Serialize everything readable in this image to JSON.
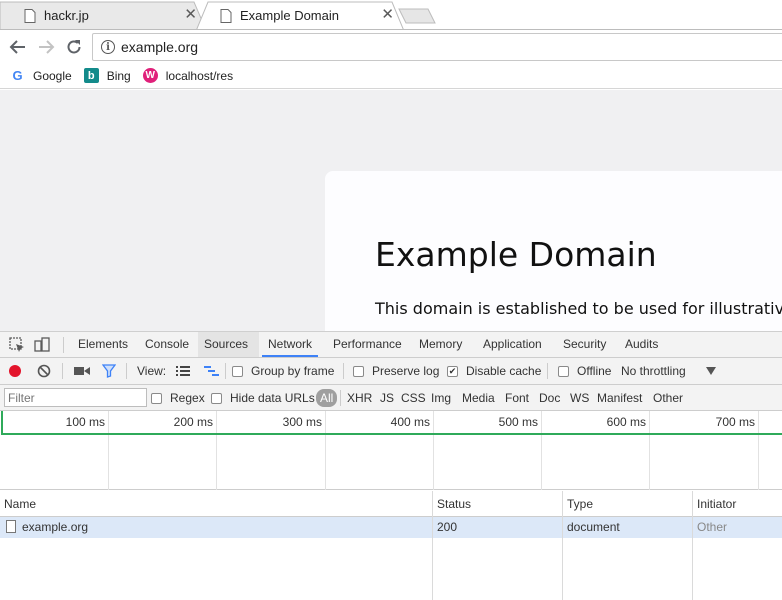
{
  "tabs": [
    {
      "title": "hackr.jp",
      "active": false,
      "favicon": "page-icon"
    },
    {
      "title": "Example Domain",
      "active": true,
      "favicon": "page-icon"
    }
  ],
  "toolbar": {
    "back_icon": "arrow-left-icon",
    "forward_icon": "arrow-right-icon",
    "reload_icon": "reload-icon",
    "url": "example.org",
    "site_info_icon": "info-icon"
  },
  "bookmarks": [
    {
      "label": "Google",
      "icon": "google-icon"
    },
    {
      "label": "Bing",
      "icon": "bing-icon"
    },
    {
      "label": "localhost/res",
      "icon": "site-icon"
    }
  ],
  "page": {
    "heading": "Example Domain",
    "paragraph": "This domain is established to be used for illustrative examples in documents."
  },
  "devtools": {
    "tabs": [
      "Elements",
      "Console",
      "Sources",
      "Network",
      "Performance",
      "Memory",
      "Application",
      "Security",
      "Audits"
    ],
    "active_tab": "Network",
    "toolbar": {
      "view_label": "View:",
      "group_by_frame": "Group by frame",
      "preserve_log": "Preserve log",
      "disable_cache": "Disable cache",
      "offline": "Offline",
      "throttling": "No throttling",
      "disable_cache_checked": true
    },
    "filter": {
      "placeholder": "Filter",
      "regex": "Regex",
      "hide_data_urls": "Hide data URLs",
      "types": [
        "All",
        "XHR",
        "JS",
        "CSS",
        "Img",
        "Media",
        "Font",
        "Doc",
        "WS",
        "Manifest",
        "Other"
      ]
    },
    "timeline_ticks": [
      "100 ms",
      "200 ms",
      "300 ms",
      "400 ms",
      "500 ms",
      "600 ms",
      "700 ms"
    ],
    "table": {
      "columns": [
        "Name",
        "Status",
        "Type",
        "Initiator"
      ],
      "rows": [
        {
          "name": "example.org",
          "status": "200",
          "type": "document",
          "initiator": "Other"
        }
      ]
    },
    "colors": {
      "accent": "#3e82f7",
      "record": "#e3142b",
      "timeline": "#2faa5a",
      "selected_row": "#dce8f8"
    }
  }
}
